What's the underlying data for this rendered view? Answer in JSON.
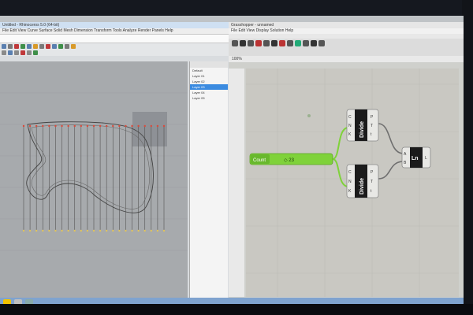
{
  "rhino": {
    "title": "Untitled - Rhinoceros 5.0 (64-bit)",
    "menu": "File  Edit  View  Curve  Surface  Solid  Mesh  Dimension  Transform  Tools  Analyze  Render  Panels  Help",
    "layers": [
      "Default",
      "Layer 01",
      "Layer 02",
      "Layer 03",
      "Layer 04",
      "Layer 05"
    ],
    "selected_layer_index": 3,
    "status": "Perspective   Snap   Ortho   Planar   Osnap   SmartTrack   Gumball   Record History   Filter"
  },
  "grasshopper": {
    "title": "Grasshopper - unnamed",
    "menu": "File  Edit  View  Display  Solution  Help",
    "zoom": "100%",
    "slider": {
      "label": "Count",
      "value": "◇ 23"
    },
    "divide_1": {
      "name": "Divide",
      "inputs": [
        "C",
        "N",
        "K"
      ],
      "outputs": [
        "P",
        "T",
        "t"
      ]
    },
    "divide_2": {
      "name": "Divide",
      "inputs": [
        "C",
        "N",
        "K"
      ],
      "outputs": [
        "P",
        "T",
        "t"
      ]
    },
    "line": {
      "name": "Ln",
      "inputs": [
        "A",
        "B"
      ],
      "outputs": [
        "L"
      ]
    }
  },
  "colors": {
    "slider_green": "#7fd23a",
    "component_dark": "#1b1b1b",
    "wire": "#6f6f6f",
    "point_red": "#d94b3c",
    "point_yellow": "#e0c35a"
  },
  "icons": [
    "rhino-toolbar-icons",
    "grasshopper-ribbon-icons",
    "taskbar-icons"
  ]
}
